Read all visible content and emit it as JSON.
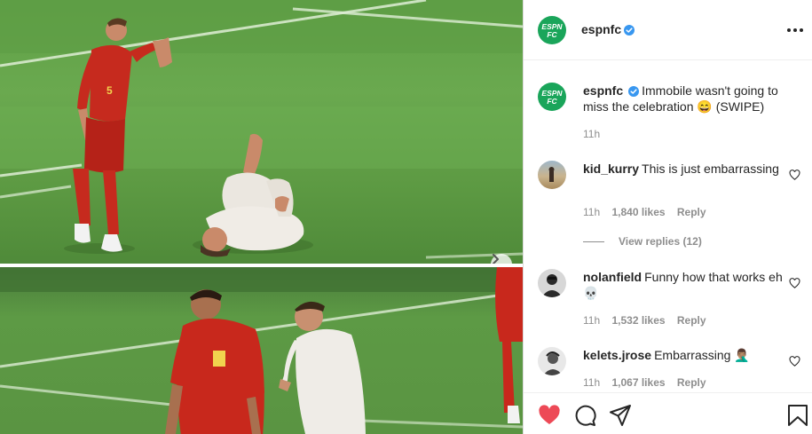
{
  "post": {
    "account": "espnfc",
    "logo_text_1": "ESPN",
    "logo_text_2": "FC",
    "caption": "Immobile wasn't going to miss the celebration 😄 (SWIPE)",
    "time": "11h",
    "player_number": "5"
  },
  "comments": [
    {
      "username": "kid_kurry",
      "text": "This is just embarrassing",
      "time": "11h",
      "likes": "1,840 likes",
      "reply": "Reply"
    },
    {
      "username": "nolanfield",
      "text": "Funny how that works eh💀",
      "time": "11h",
      "likes": "1,532 likes",
      "reply": "Reply"
    },
    {
      "username": "kelets.jrose",
      "text": "Embarrassing 🤦🏽‍♂️",
      "time": "11h",
      "likes": "1,067 likes",
      "reply": "Reply"
    }
  ],
  "view_replies": "View replies (12)",
  "icons": {
    "verified": "verified-badge-icon",
    "more": "more-options-icon",
    "like": "heart-icon",
    "comment": "comment-icon",
    "share": "share-icon",
    "save": "bookmark-icon",
    "next": "chevron-right-icon"
  },
  "colors": {
    "brand": "#1aa55a",
    "verified": "#3897f0",
    "like": "#ed4956",
    "muted": "#8e8e8e",
    "text": "#262626"
  }
}
